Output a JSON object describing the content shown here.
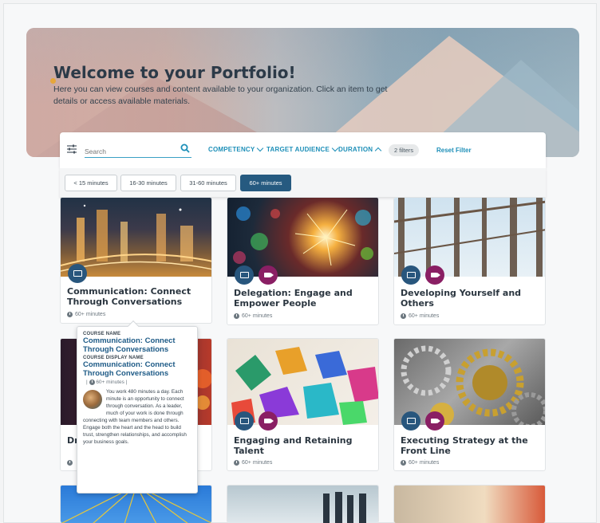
{
  "hero": {
    "title": "Welcome to your Portfolio!",
    "description": "Here you can view courses and content available to your organization. Click an item to get details or access available materials."
  },
  "filters": {
    "search_placeholder": "Search",
    "competency": "COMPETENCY",
    "target_audience": "TARGET AUDIENCE",
    "duration": "DURATION",
    "count_badge": "2 filters",
    "reset": "Reset Filter",
    "duration_options": [
      "< 15 minutes",
      "16-30 minutes",
      "31-60 minutes",
      "60+ minutes"
    ],
    "selected_duration": "60+ minutes"
  },
  "cards": [
    {
      "title": "Communication: Connect Through Conversations",
      "duration": "60+ minutes",
      "types": [
        "course"
      ]
    },
    {
      "title": "Delegation: Engage and Empower People",
      "duration": "60+ minutes",
      "types": [
        "course",
        "video"
      ]
    },
    {
      "title": "Developing Yourself and Others",
      "duration": "60+ minutes",
      "types": [
        "course",
        "video"
      ]
    },
    {
      "title": "Dr",
      "duration": "60+ minutes",
      "types": []
    },
    {
      "title": "Engaging and Retaining Talent",
      "duration": "60+ minutes",
      "types": [
        "course",
        "video"
      ]
    },
    {
      "title": "Executing Strategy at the Front Line",
      "duration": "60+ minutes",
      "types": [
        "course",
        "video"
      ]
    }
  ],
  "tooltip": {
    "course_name_label": "COURSE NAME",
    "course_name": "Communication: Connect Through Conversations",
    "display_name_label": "COURSE DISPLAY NAME",
    "display_name": "Communication: Connect Through Conversations",
    "duration": "60+ minutes",
    "description": "You work 480 minutes a day. Each minute is an opportunity to connect through conversation. As a leader, much of your work is done through connecting with team members and others. Engage both the heart and the head to build trust, strengthen relationships, and accomplish your business goals."
  },
  "colors": {
    "accent": "#1d8fb8",
    "course_badge": "#28567d",
    "video_badge": "#8a1f64",
    "active_chip": "#265a80"
  }
}
